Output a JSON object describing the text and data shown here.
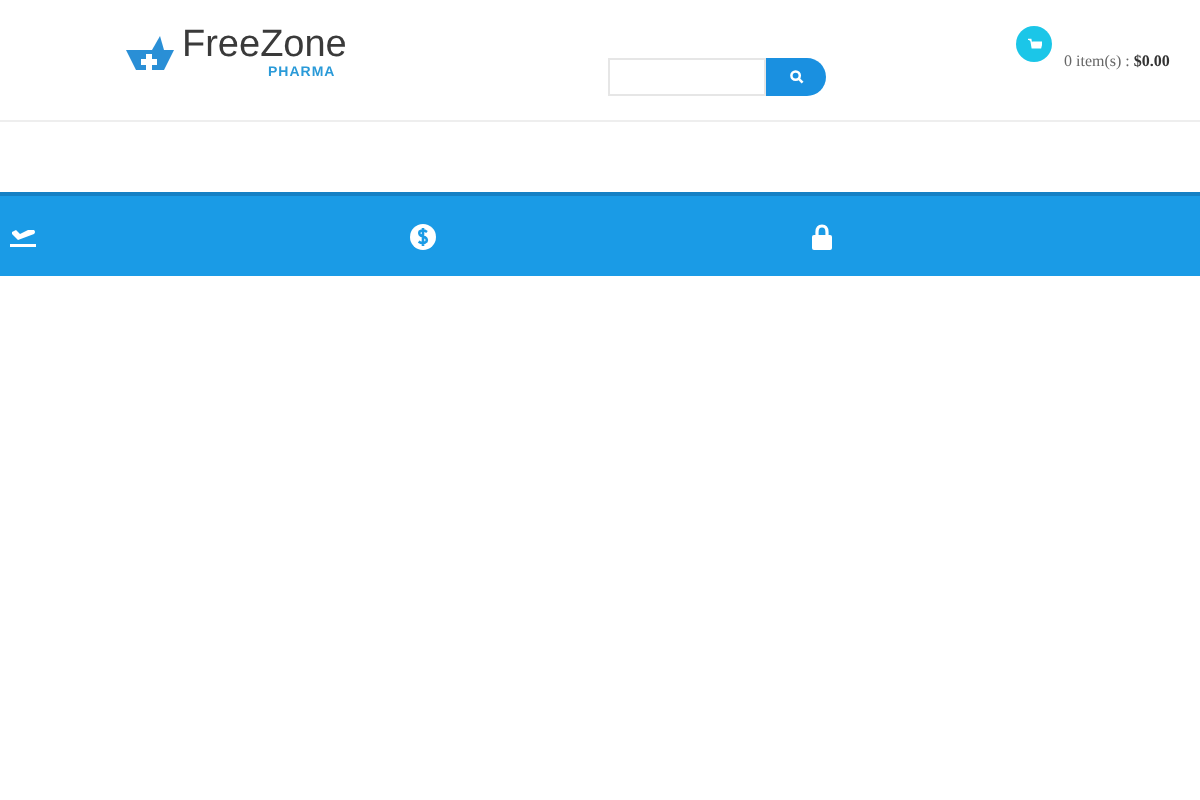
{
  "logo": {
    "name": "FreeZone",
    "tagline": "PHARMA"
  },
  "cart": {
    "summary": "0 item(s) : **$0.00**"
  }
}
